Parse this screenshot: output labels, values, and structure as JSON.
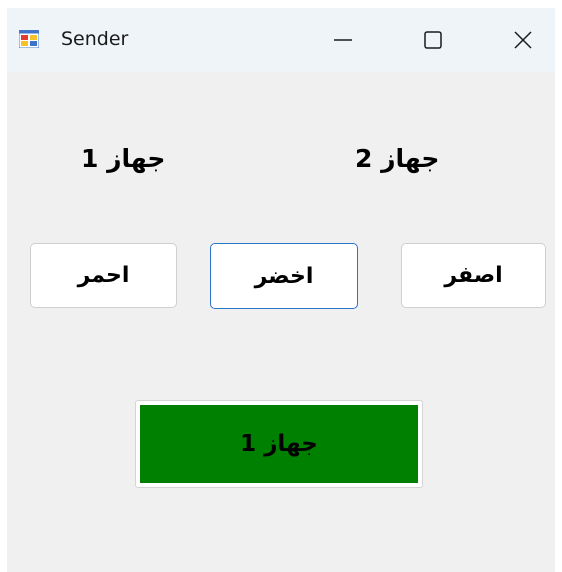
{
  "window": {
    "title": "Sender",
    "icon": "windows-form-app-icon"
  },
  "caption_buttons": {
    "minimize_icon": "minimize-icon",
    "maximize_icon": "maximize-icon",
    "close_icon": "close-icon"
  },
  "labels": {
    "device1": "جهاز 1",
    "device2": "جهاز 2"
  },
  "buttons": {
    "red_label": "احمر",
    "green_label": "اخضر",
    "yellow_label": "اصفر"
  },
  "status": {
    "text": "جهاز 1",
    "background": "#008000"
  },
  "colors": {
    "window_bg": "#f0f0f0",
    "titlebar_bg": "#eff4f9",
    "focus_border": "#2b75c6"
  }
}
